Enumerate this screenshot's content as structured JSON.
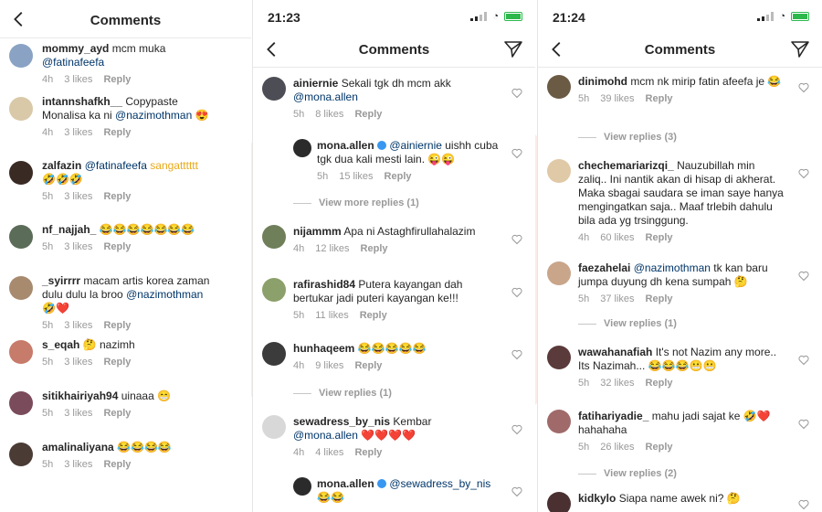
{
  "panels": [
    {
      "title": "Comments",
      "comments": [
        {
          "user": "mommy_ayd",
          "text": "mcm muka ",
          "mention": "@fatinafeefa",
          "emoji": "",
          "time": "4h",
          "likes": "3 likes",
          "reply": "Reply"
        },
        {
          "user": "intannshafkh__",
          "text": "Copypaste Monalisa ka ni ",
          "mention": "@nazimothman",
          "emoji": "😍",
          "time": "4h",
          "likes": "3 likes",
          "reply": "Reply"
        },
        {
          "user": "zalfazin",
          "text": "",
          "mention": "@fatinafeefa",
          "emoji": "sangatttttt 🤣🤣🤣",
          "time": "5h",
          "likes": "3 likes",
          "reply": "Reply"
        },
        {
          "user": "nf_najjah_",
          "text": "",
          "mention": "",
          "emoji": "😂😂😂😂😂😂😂",
          "time": "5h",
          "likes": "3 likes",
          "reply": "Reply"
        },
        {
          "user": "_syirrrr",
          "text": "macam artis korea zaman dulu dulu la broo ",
          "mention": "@nazimothman",
          "emoji": "🤣❤️",
          "time": "5h",
          "likes": "3 likes",
          "reply": "Reply"
        },
        {
          "user": "s_eqah",
          "text": "🤔 nazimh",
          "mention": "",
          "emoji": "",
          "time": "5h",
          "likes": "3 likes",
          "reply": "Reply"
        },
        {
          "user": "sitikhairiyah94",
          "text": "uinaaa ",
          "mention": "",
          "emoji": "😁",
          "time": "5h",
          "likes": "3 likes",
          "reply": "Reply"
        },
        {
          "user": "amalinaliyana",
          "text": "",
          "mention": "",
          "emoji": "😂😂😂😂",
          "time": "5h",
          "likes": "3 likes",
          "reply": "Reply"
        }
      ]
    },
    {
      "time": "21:23",
      "title": "Comments",
      "comments": [
        {
          "user": "ainiernie",
          "text": "Sekali tgk dh mcm akk ",
          "mention": "@mona.allen",
          "emoji": "",
          "time": "5h",
          "likes": "8 likes",
          "reply": "Reply"
        },
        {
          "user": "mona.allen",
          "text": "",
          "mention": "@ainiernie",
          "emoji": " uishh cuba tgk dua kali mesti lain. 😜😜",
          "time": "5h",
          "likes": "15 likes",
          "reply": "Reply"
        },
        {
          "user": "nijammm",
          "text": "Apa ni Astaghfirullahalazim",
          "mention": "",
          "emoji": "",
          "time": "4h",
          "likes": "12 likes",
          "reply": "Reply"
        },
        {
          "user": "rafirashid84",
          "text": "Putera kayangan dah bertukar jadi puteri kayangan ke!!!",
          "mention": "",
          "emoji": "",
          "time": "5h",
          "likes": "11 likes",
          "reply": "Reply"
        },
        {
          "user": "hunhaqeem",
          "text": "",
          "mention": "",
          "emoji": "😂😂😂😂😂",
          "time": "4h",
          "likes": "9 likes",
          "reply": "Reply"
        },
        {
          "user": "sewadress_by_nis",
          "text": "Kembar ",
          "mention": "@mona.allen",
          "emoji": "❤️❤️❤️❤️",
          "time": "4h",
          "likes": "4 likes",
          "reply": "Reply"
        },
        {
          "user": "mona.allen",
          "text": "",
          "mention": "@sewadress_by_nis",
          "emoji": "😂😂",
          "time": "",
          "likes": "",
          "reply": ""
        }
      ],
      "view_more": "View more replies (1)",
      "view_replies": "View replies (1)"
    },
    {
      "time": "21:24",
      "title": "Comments",
      "comments": [
        {
          "user": "dinimohd",
          "text": "mcm nk mirip fatin afeefa je ",
          "mention": "",
          "emoji": "😂",
          "time": "5h",
          "likes": "39 likes",
          "reply": "Reply"
        },
        {
          "user": "chechemariarizqi_",
          "text": "Nauzubillah min zaliq.. Ini nantik akan di hisap di akherat. Maka sbagai saudara se iman saye hanya mengingatkan saja.. Maaf trlebih dahulu bila ada yg trsinggung.",
          "mention": "",
          "emoji": "",
          "time": "4h",
          "likes": "60 likes",
          "reply": "Reply"
        },
        {
          "user": "faezahelai",
          "text": "",
          "mention": "@nazimothman",
          "emoji": " tk kan baru jumpa duyung dh kena sumpah 🤔",
          "time": "5h",
          "likes": "37 likes",
          "reply": "Reply"
        },
        {
          "user": "wawahanafiah",
          "text": "It's not Nazim any more.. Its Nazimah... ",
          "mention": "",
          "emoji": "😂😂😂😬😬",
          "time": "5h",
          "likes": "32 likes",
          "reply": "Reply"
        },
        {
          "user": "fatihariyadie_",
          "text": "mahu jadi sajat ke ",
          "mention": "",
          "emoji": "🤣❤️ hahahaha",
          "time": "5h",
          "likes": "26 likes",
          "reply": "Reply"
        },
        {
          "user": "kidkylo",
          "text": "Siapa name awek ni? ",
          "mention": "",
          "emoji": "🤔",
          "time": "",
          "likes": "",
          "reply": ""
        }
      ],
      "view_replies_1": "View replies (3)",
      "view_replies_2": "View replies (1)",
      "view_replies_3": "View replies (2)"
    }
  ],
  "colors": {
    "mention": "#003569",
    "meta": "#999999",
    "verified": "#3897f0",
    "battery": "#2db84c"
  }
}
